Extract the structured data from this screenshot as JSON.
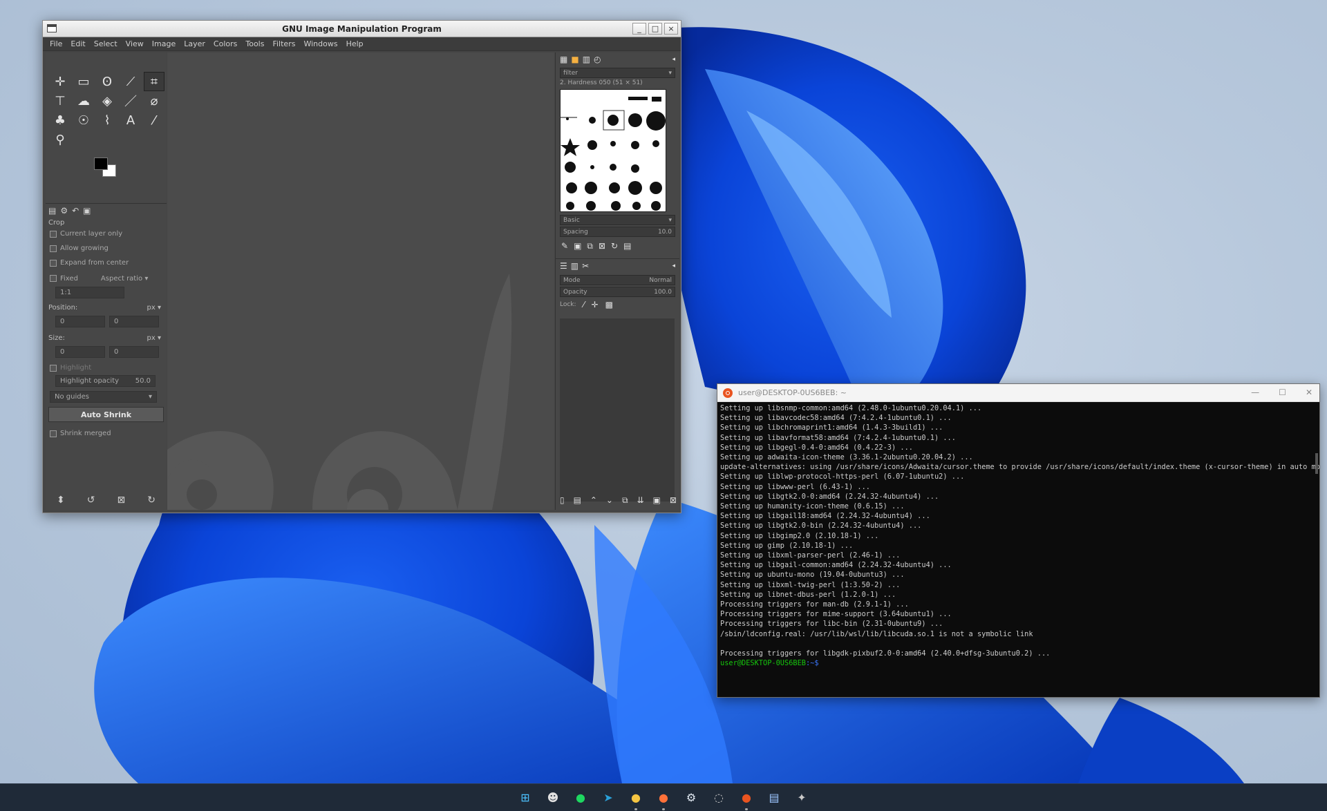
{
  "gimp": {
    "title": "GNU Image Manipulation Program",
    "buttons": {
      "minimize": "_",
      "maximize": "□",
      "close": "×"
    },
    "menu": [
      "File",
      "Edit",
      "Select",
      "View",
      "Image",
      "Layer",
      "Colors",
      "Tools",
      "Filters",
      "Windows",
      "Help"
    ],
    "tool_icons": [
      [
        "move-tool-icon",
        "✛"
      ],
      [
        "rect-select-tool-icon",
        "▭"
      ],
      [
        "free-select-tool-icon",
        "ʘ"
      ],
      [
        "fuzzy-select-tool-icon",
        "⟋"
      ],
      [
        "crop-tool-icon",
        "⌗"
      ],
      [
        "transform-tool-icon",
        "⊤"
      ],
      [
        "warp-tool-icon",
        "☁"
      ],
      [
        "bucket-fill-tool-icon",
        "◈"
      ],
      [
        "paintbrush-tool-icon",
        "／"
      ],
      [
        "eraser-tool-icon",
        "⌀"
      ],
      [
        "clone-tool-icon",
        "♣"
      ],
      [
        "smudge-tool-icon",
        "☉"
      ],
      [
        "paths-tool-icon",
        "⌇"
      ],
      [
        "text-tool-icon",
        "A"
      ],
      [
        "color-picker-tool-icon",
        "⁄"
      ],
      [
        "zoom-tool-icon",
        "⚲"
      ]
    ],
    "tool_options": {
      "section": "Crop",
      "current_layer_only": "Current layer only",
      "allow_growing": "Allow growing",
      "expand_from_center": "Expand from center",
      "fixed": "Fixed",
      "aspect_ratio": "Aspect ratio",
      "ratio_value": "1:1",
      "position_label": "Position:",
      "position_unit": "px",
      "position_x": "0",
      "position_y": "0",
      "size_label": "Size:",
      "size_unit": "px",
      "size_w": "0",
      "size_h": "0",
      "highlight": "Highlight",
      "highlight_opacity": "Highlight opacity",
      "highlight_opacity_value": "50.0",
      "guides": "No guides",
      "auto_shrink": "Auto Shrink",
      "shrink_merged": "Shrink merged"
    },
    "dock": {
      "brush_filter": "filter",
      "brush_name": "2. Hardness 050 (51 × 51)",
      "brush_preset": "Basic",
      "spacing_label": "Spacing",
      "spacing_value": "10.0",
      "mode_label": "Mode",
      "mode_value": "Normal",
      "opacity_label": "Opacity",
      "opacity_value": "100.0",
      "lock_label": "Lock:"
    }
  },
  "terminal": {
    "title": "user@DESKTOP-0US6BEB: ~",
    "buttons": {
      "minimize": "—",
      "maximize": "☐",
      "close": "✕"
    },
    "lines": [
      "Setting up libsnmp-common:amd64 (2.48.0-1ubuntu0.20.04.1) ...",
      "Setting up libavcodec58:amd64 (7:4.2.4-1ubuntu0.1) ...",
      "Setting up libchromaprint1:amd64 (1.4.3-3build1) ...",
      "Setting up libavformat58:amd64 (7:4.2.4-1ubuntu0.1) ...",
      "Setting up libgegl-0.4-0:amd64 (0.4.22-3) ...",
      "Setting up adwaita-icon-theme (3.36.1-2ubuntu0.20.04.2) ...",
      "update-alternatives: using /usr/share/icons/Adwaita/cursor.theme to provide /usr/share/icons/default/index.theme (x-cursor-theme) in auto mode",
      "Setting up liblwp-protocol-https-perl (6.07-1ubuntu2) ...",
      "Setting up libwww-perl (6.43-1) ...",
      "Setting up libgtk2.0-0:amd64 (2.24.32-4ubuntu4) ...",
      "Setting up humanity-icon-theme (0.6.15) ...",
      "Setting up libgail18:amd64 (2.24.32-4ubuntu4) ...",
      "Setting up libgtk2.0-bin (2.24.32-4ubuntu4) ...",
      "Setting up libgimp2.0 (2.10.18-1) ...",
      "Setting up gimp (2.10.18-1) ...",
      "Setting up libxml-parser-perl (2.46-1) ...",
      "Setting up libgail-common:amd64 (2.24.32-4ubuntu4) ...",
      "Setting up ubuntu-mono (19.04-0ubuntu3) ...",
      "Setting up libxml-twig-perl (1:3.50-2) ...",
      "Setting up libnet-dbus-perl (1.2.0-1) ...",
      "Processing triggers for man-db (2.9.1-1) ...",
      "Processing triggers for mime-support (3.64ubuntu1) ...",
      "Processing triggers for libc-bin (2.31-0ubuntu9) ...",
      "/sbin/ldconfig.real: /usr/lib/wsl/lib/libcuda.so.1 is not a symbolic link",
      "",
      "Processing triggers for libgdk-pixbuf2.0-0:amd64 (2.40.0+dfsg-3ubuntu0.2) ..."
    ],
    "prompt_user": "user@DESKTOP-0US6BEB",
    "prompt_path": ":~$"
  },
  "taskbar": {
    "icons": [
      [
        "start-icon",
        "⊞",
        "#4cc2ff"
      ],
      [
        "alien-app-icon",
        "☻",
        "#e0e0e0"
      ],
      [
        "spotify-icon",
        "●",
        "#1ed760"
      ],
      [
        "telegram-icon",
        "➤",
        "#2aa1da"
      ],
      [
        "lightbulb-icon",
        "●",
        "#f5c542"
      ],
      [
        "firefox-icon",
        "●",
        "#ff7139"
      ],
      [
        "steam-icon",
        "⚙",
        "#dfe7f0"
      ],
      [
        "circle-app-icon",
        "◌",
        "#c8c8c8"
      ],
      [
        "ubuntu-icon",
        "●",
        "#e95420"
      ],
      [
        "document-icon",
        "▤",
        "#9cc6ff"
      ],
      [
        "gimp-icon",
        "✦",
        "#c9c9c9"
      ]
    ]
  }
}
